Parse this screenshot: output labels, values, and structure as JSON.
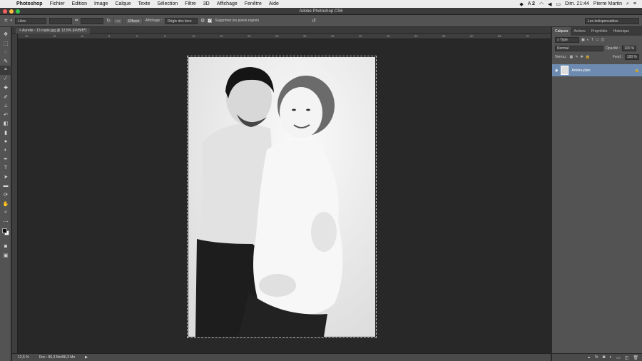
{
  "menubar": {
    "items": [
      "Photoshop",
      "Fichier",
      "Edition",
      "Image",
      "Calque",
      "Texte",
      "Sélection",
      "Filtre",
      "3D",
      "Affichage",
      "Fenêtre",
      "Aide"
    ],
    "clock": "Dim. 21:44",
    "user": "Pierre Martin",
    "badge": "2"
  },
  "titlebar": {
    "title": "Adobe Photoshop CS6"
  },
  "options": {
    "ratio": "Libre",
    "clear": "Effacer",
    "view_label": "Affichage :",
    "view_value": "Règle des tiers",
    "delete_cropped": "Supprimer les pixels rognés",
    "workspace": "Les indispensables"
  },
  "document": {
    "tab": "Aurelie - 13 copie.jpg @ 12,5% (RVB/8*)",
    "zoom": "12,5 %",
    "doc_size": "Doc : 86,3 Mo/86,3 Mo"
  },
  "ruler": {
    "h_ticks": [
      "20",
      "15",
      "10",
      "5",
      "0",
      "5",
      "10",
      "15",
      "20",
      "25",
      "30",
      "35",
      "40",
      "45",
      "50",
      "55",
      "60",
      "65",
      "70"
    ]
  },
  "panel": {
    "tabs": [
      "Calques",
      "Actions",
      "Propriétés",
      "Historique"
    ],
    "filter": "Type",
    "blend": "Normal",
    "opacity_label": "Opacité :",
    "opacity": "100 %",
    "lock_label": "Verrou :",
    "fill_label": "Fond :",
    "fill": "100 %",
    "layer_name": "Arrière-plan"
  },
  "colors": {
    "accent": "#6d8bb0",
    "panel": "#535353",
    "canvas": "#282828"
  }
}
